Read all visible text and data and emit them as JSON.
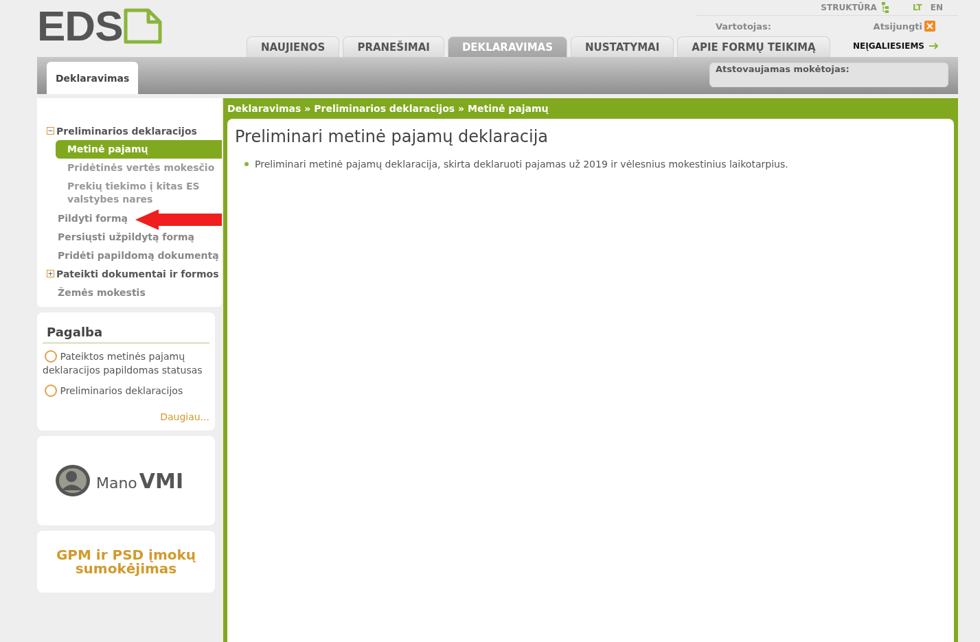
{
  "header": {
    "logo": "EDS",
    "structure_link": "STRUKTŪRA",
    "languages": [
      {
        "label": "LT",
        "selected": true
      },
      {
        "label": "EN",
        "selected": false
      }
    ],
    "user_label": "Vartotojas:",
    "logout": "Atsijungti",
    "accessibility_link": "NEĮGALIESIEMS"
  },
  "tabs": [
    {
      "label": "NAUJIENOS",
      "selected": false
    },
    {
      "label": "PRANEŠIMAI",
      "selected": false
    },
    {
      "label": "DEKLARAVIMAS",
      "selected": true
    },
    {
      "label": "NUSTATYMAI",
      "selected": false
    },
    {
      "label": "APIE FORMŲ TEIKIMĄ",
      "selected": false
    }
  ],
  "subtabs": [
    {
      "label": "Deklaravimas",
      "selected": true
    }
  ],
  "represented_payer": {
    "label": "Atstovaujamas mokėtojas:"
  },
  "sidebar": {
    "items": [
      {
        "label": "Preliminarios deklaracijos",
        "expanded": true,
        "selected": false,
        "children": [
          {
            "label": "Metinė pajamų",
            "selected": true
          },
          {
            "label": "Pridėtinės vertės mokesčio",
            "selected": false
          },
          {
            "label": "Prekių tiekimo į kitas ES valstybes nares",
            "selected": false
          }
        ]
      },
      {
        "label": "Pildyti formą",
        "selected": false
      },
      {
        "label": "Persiųsti užpildytą formą",
        "selected": false
      },
      {
        "label": "Pridėti papildomą dokumentą",
        "selected": false
      },
      {
        "label": "Pateikti dokumentai ir formos",
        "expanded": false,
        "selected": false
      },
      {
        "label": "Žemės mokestis",
        "selected": false
      }
    ]
  },
  "help": {
    "title": "Pagalba",
    "links": [
      "Pateiktos metinės pajamų deklaracijos papildomas statusas",
      "Preliminarios deklaracijos"
    ],
    "more": "Daugiau..."
  },
  "promo_logo": {
    "prefix": "Mano",
    "name": "VMI"
  },
  "payment_link": "GPM ir PSD įmokų sumokėjimas",
  "breadcrumb": [
    "Deklaravimas »",
    "Preliminarios deklaracijos",
    "» Metinė pajamų"
  ],
  "content": {
    "title": "Preliminari metinė pajamų deklaracija",
    "bullets": [
      "Preliminari metinė pajamų deklaracija, skirta deklaruoti pajamas už 2019 ir vėlesnius mokestinius laikotarpius."
    ]
  },
  "annotation": {
    "kind": "arrow"
  }
}
